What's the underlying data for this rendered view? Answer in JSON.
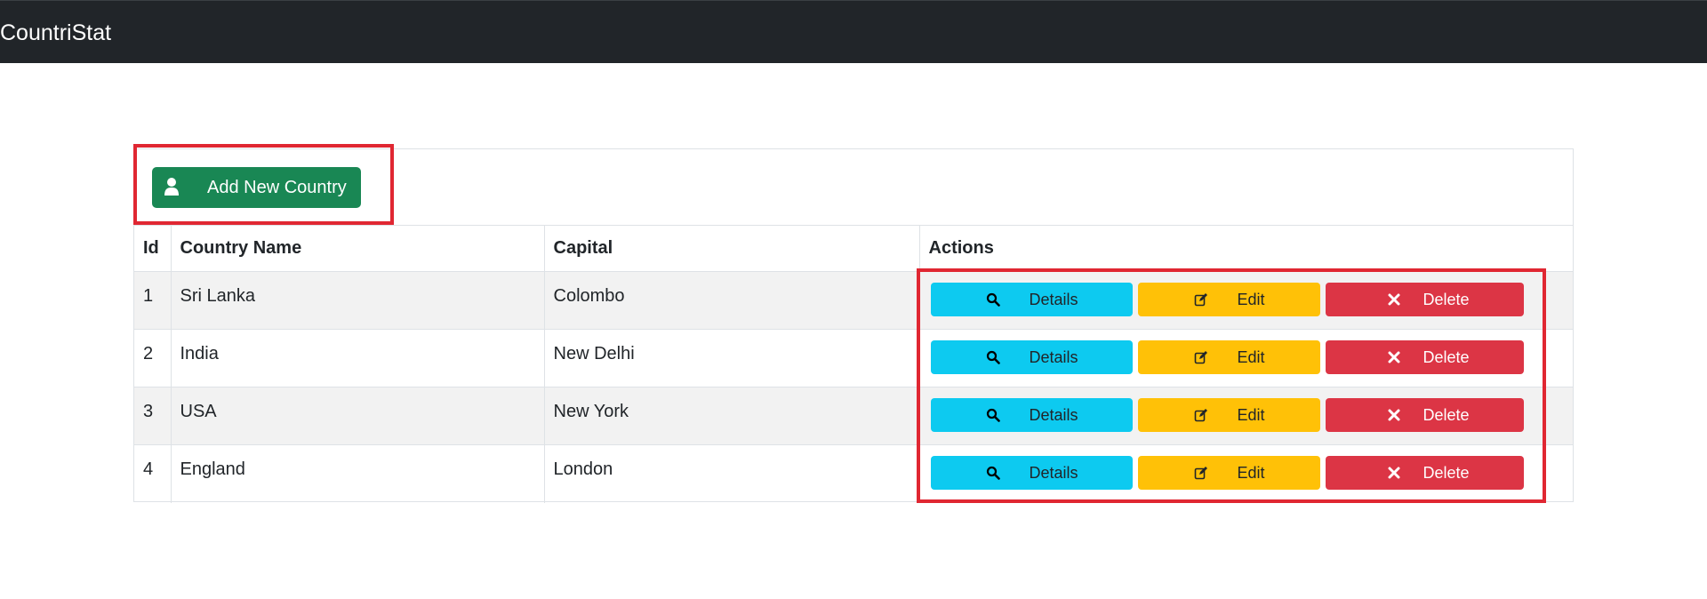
{
  "navbar": {
    "brand": "CountriStat"
  },
  "toolbar": {
    "add_label": "Add New Country",
    "add_icon": "user-icon"
  },
  "table": {
    "headers": [
      "Id",
      "Country Name",
      "Capital",
      "Actions"
    ],
    "rows": [
      {
        "id": "1",
        "country": "Sri Lanka",
        "capital": "Colombo"
      },
      {
        "id": "2",
        "country": "India",
        "capital": "New Delhi"
      },
      {
        "id": "3",
        "country": "USA",
        "capital": "New York"
      },
      {
        "id": "4",
        "country": "England",
        "capital": "London"
      }
    ]
  },
  "actions": {
    "details_label": "Details",
    "edit_label": "Edit",
    "delete_label": "Delete",
    "details_icon": "search-icon",
    "edit_icon": "edit-icon",
    "delete_icon": "close-icon"
  },
  "colors": {
    "navbar": "#212529",
    "add_button": "#198754",
    "details_button": "#0dcaf0",
    "edit_button": "#ffc107",
    "delete_button": "#dc3545",
    "highlight": "#e02732"
  }
}
